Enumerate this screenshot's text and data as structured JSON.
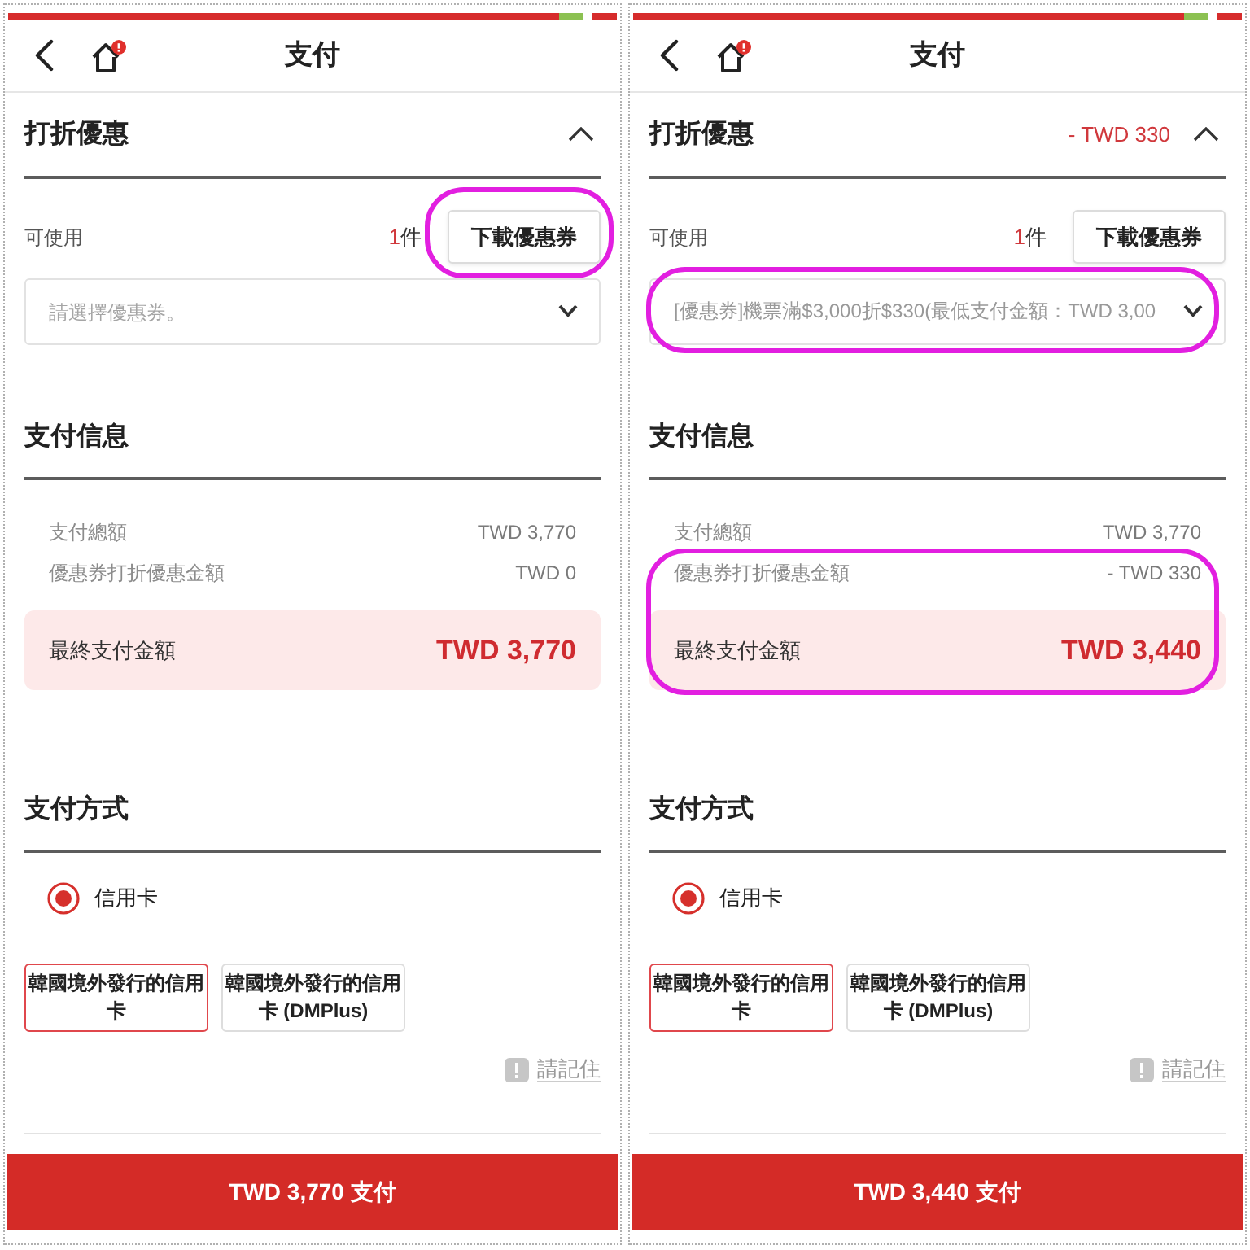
{
  "screens": [
    {
      "title": "支付",
      "discount": {
        "title": "打折優惠",
        "expanded": true,
        "available_label": "可使用",
        "count": "1",
        "count_unit": "件",
        "download_button": {
          "label": "下載優惠券",
          "circled": true
        },
        "coupon_select": {
          "placeholder": "請選擇優惠券。",
          "circled": false
        }
      },
      "payment_info": {
        "title": "支付信息",
        "rows": [
          {
            "label": "支付總額",
            "value": "TWD 3,770",
            "circled": false
          },
          {
            "label": "優惠券打折優惠金額",
            "value": "TWD 0",
            "circled": false
          }
        ],
        "final": {
          "label": "最終支付金額",
          "value": "TWD 3,770",
          "circled": false
        }
      },
      "payment_method": {
        "title": "支付方式",
        "options": [
          {
            "label": "信用卡",
            "selected": true
          }
        ],
        "cards": [
          {
            "label": "韓國境外發行的信用卡",
            "selected": true
          },
          {
            "label": "韓國境外發行的信用卡 (DMPlus)",
            "selected": false
          }
        ],
        "notice_link": "請記住"
      },
      "pay_button": "TWD 3,770 支付"
    },
    {
      "title": "支付",
      "discount": {
        "title": "打折優惠",
        "amount": "- TWD 330",
        "expanded": true,
        "available_label": "可使用",
        "count": "1",
        "count_unit": "件",
        "download_button": {
          "label": "下載優惠券",
          "circled": false
        },
        "coupon_select": {
          "value": "[優惠券]機票滿$3,000折$330(最低支付金額：TWD 3,00",
          "circled": true
        }
      },
      "payment_info": {
        "title": "支付信息",
        "rows": [
          {
            "label": "支付總額",
            "value": "TWD 3,770",
            "circled": false
          },
          {
            "label": "優惠券打折優惠金額",
            "value": "- TWD 330",
            "circled": true
          }
        ],
        "final": {
          "label": "最終支付金額",
          "value": "TWD 3,440",
          "circled": true
        }
      },
      "payment_method": {
        "title": "支付方式",
        "options": [
          {
            "label": "信用卡",
            "selected": true
          }
        ],
        "cards": [
          {
            "label": "韓國境外發行的信用卡",
            "selected": true
          },
          {
            "label": "韓國境外發行的信用卡 (DMPlus)",
            "selected": false
          }
        ],
        "notice_link": "請記住"
      },
      "pay_button": "TWD 3,440 支付"
    }
  ]
}
